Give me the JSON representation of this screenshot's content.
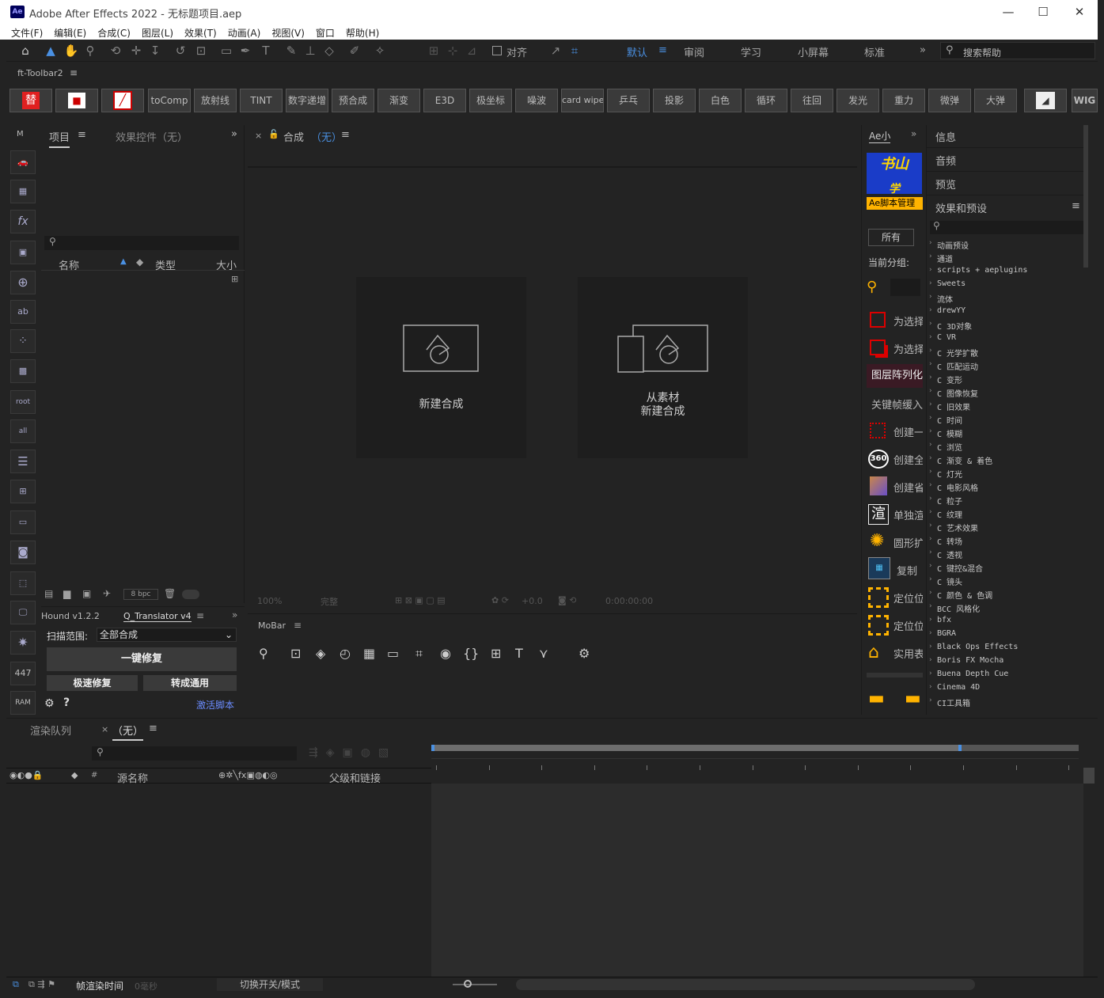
{
  "window": {
    "title": "Adobe After Effects 2022 - 无标题项目.aep",
    "logo": "Ae",
    "min": "—",
    "max": "☐",
    "close": "✕"
  },
  "menu": [
    "文件(F)",
    "编辑(E)",
    "合成(C)",
    "图层(L)",
    "效果(T)",
    "动画(A)",
    "视图(V)",
    "窗口",
    "帮助(H)"
  ],
  "toolbar": {
    "align_label": "对齐",
    "workspaces": [
      "默认",
      "审阅",
      "学习",
      "小屏幕",
      "标准"
    ],
    "more": "»",
    "search_placeholder": "搜索帮助"
  },
  "ft_toolbar": {
    "title": "ft-Toolbar2",
    "buttons": [
      "toComp",
      "放射线",
      "TINT",
      "数字递增",
      "预合成",
      "渐变",
      "E3D",
      "极坐标",
      "噪波",
      "card wipe",
      "乒乓",
      "投影",
      "白色",
      "循环",
      "往回",
      "发光",
      "重力",
      "微弹",
      "大弹"
    ],
    "last": "WIG"
  },
  "project_panel": {
    "tab_project": "项目",
    "tab_effects": "效果控件（无）",
    "col_name": "名称",
    "col_type": "类型",
    "col_size": "大小",
    "bpc": "8 bpc"
  },
  "comp_panel": {
    "tab": "合成",
    "tab_none": "（无）",
    "new_comp": "新建合成",
    "from_footage_line1": "从素材",
    "from_footage_line2": "新建合成",
    "zoom": "100%",
    "quality": "完整",
    "exposure": "+0.0",
    "timecode": "0:00:00:00"
  },
  "hound": {
    "tab1": "Hound v1.2.2",
    "tab2": "Q_Translator v4",
    "scope_label": "扫描范围:",
    "scope_value": "全部合成",
    "fix_one": "一键修复",
    "fast_fix": "极速修复",
    "convert": "转成通用",
    "activate": "激活脚本"
  },
  "mobar": {
    "title": "MoBar"
  },
  "ae_small": {
    "tab": "Ae小",
    "banner_text": "书山",
    "banner_sub": "学",
    "script_mgr": "Ae脚本管理",
    "all": "所有",
    "group": "当前分组:",
    "items": [
      "为选择",
      "为选择",
      "图层阵列化",
      "关键帧缓入",
      "创建一",
      "创建全",
      "创建省",
      "单独渲",
      "圆形扩",
      "复制",
      "定位位",
      "定位位",
      "实用表"
    ]
  },
  "right_panels": {
    "info": "信息",
    "audio": "音频",
    "preview": "预览",
    "effects": "效果和预设"
  },
  "effects_list": [
    "动画预设",
    "通道",
    "scripts + aeplugins",
    "Sweets",
    "流体",
    "drewYY",
    "C 3D对象",
    "C VR",
    "C 光学扩散",
    "C 匹配运动",
    "C 变形",
    "C 图像恢复",
    "C 旧效果",
    "C 时间",
    "C 模糊",
    "C 浏览",
    "C 渐变 & 着色",
    "C 灯光",
    "C 电影风格",
    "C 粒子",
    "C 纹理",
    "C 艺术效果",
    "C 转场",
    "C 透视",
    "C 键控&混合",
    "C 镜头",
    "C 颜色 & 色调",
    "BCC 风格化",
    "bfx",
    "BGRA",
    "Black Ops Effects",
    "Boris FX Mocha",
    "Buena Depth Cue",
    "Cinema 4D",
    "CI工具箱"
  ],
  "timeline": {
    "render_queue": "渲染队列",
    "tab_none": "（无）",
    "col_source": "源名称",
    "col_parent": "父级和链接",
    "frame_render": "帧渲染时间",
    "frame_ms": "0毫秒",
    "toggle": "切换开关/模式",
    "hash": "#"
  },
  "left_icons": [
    "447",
    "RAM"
  ]
}
